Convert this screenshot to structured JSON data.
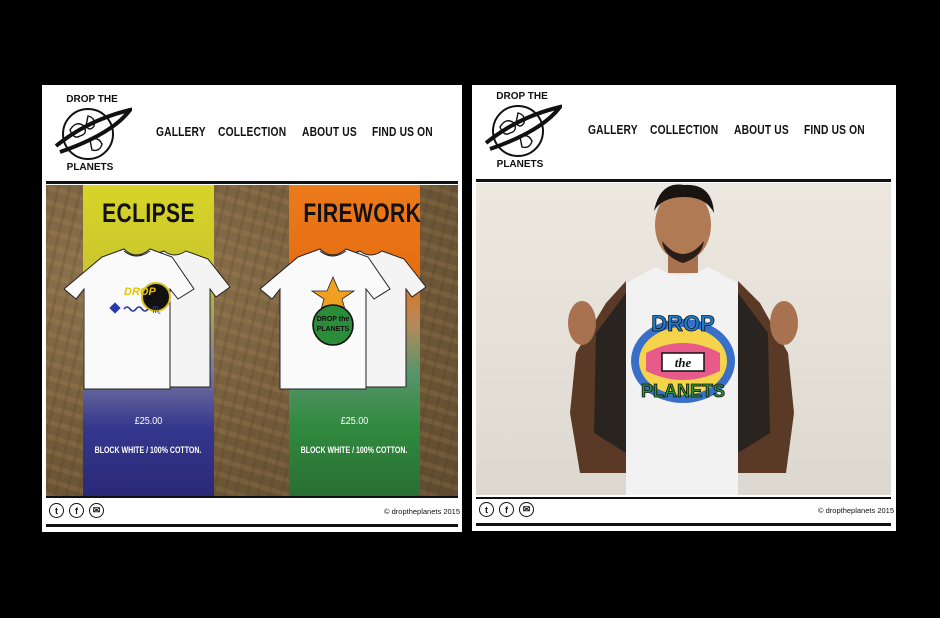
{
  "left_page": {
    "logo": {
      "alt": "DROP THE PLANETS",
      "top_text": "DROP THE",
      "bottom_text": "PLANETS"
    },
    "nav": [
      {
        "label": "GALLERY"
      },
      {
        "label": "COLLECTION"
      },
      {
        "label": "ABOUT US"
      },
      {
        "label": "FIND US ON"
      }
    ],
    "products": [
      {
        "title": "ECLIPSE",
        "price": "£25.00",
        "description": "BLOCK WHITE / 100% COTTON.",
        "strip_top": "#d8d428",
        "strip_bottom": "#2a2877"
      },
      {
        "title": "FIREWORK",
        "price": "£25.00",
        "description": "BLOCK WHITE / 100% COTTON.",
        "strip_top": "#ec7a1a",
        "strip_bottom": "#2a6e33"
      }
    ],
    "footer": {
      "social_icons": [
        "twitter-icon",
        "facebook-icon",
        "email-icon"
      ],
      "copyright": "© droptheplanets 2015"
    }
  },
  "right_page": {
    "logo": {
      "alt": "DROP THE PLANETS",
      "top_text": "DROP THE",
      "bottom_text": "PLANETS"
    },
    "nav": [
      {
        "label": "GALLERY"
      },
      {
        "label": "COLLECTION"
      },
      {
        "label": "ABOUT US"
      },
      {
        "label": "FIND US ON"
      }
    ],
    "photo": {
      "shirt_text_top": "DROP",
      "shirt_text_mid": "the",
      "shirt_text_bottom": "PLANETS"
    },
    "footer": {
      "social_icons": [
        "twitter-icon",
        "facebook-icon",
        "email-icon"
      ],
      "copyright": "© droptheplanets 2015"
    }
  },
  "colors": {
    "background": "#000000",
    "page": "#ffffff",
    "text": "#111111",
    "jacket": "#5a3a26",
    "skin": "#b07a55"
  }
}
